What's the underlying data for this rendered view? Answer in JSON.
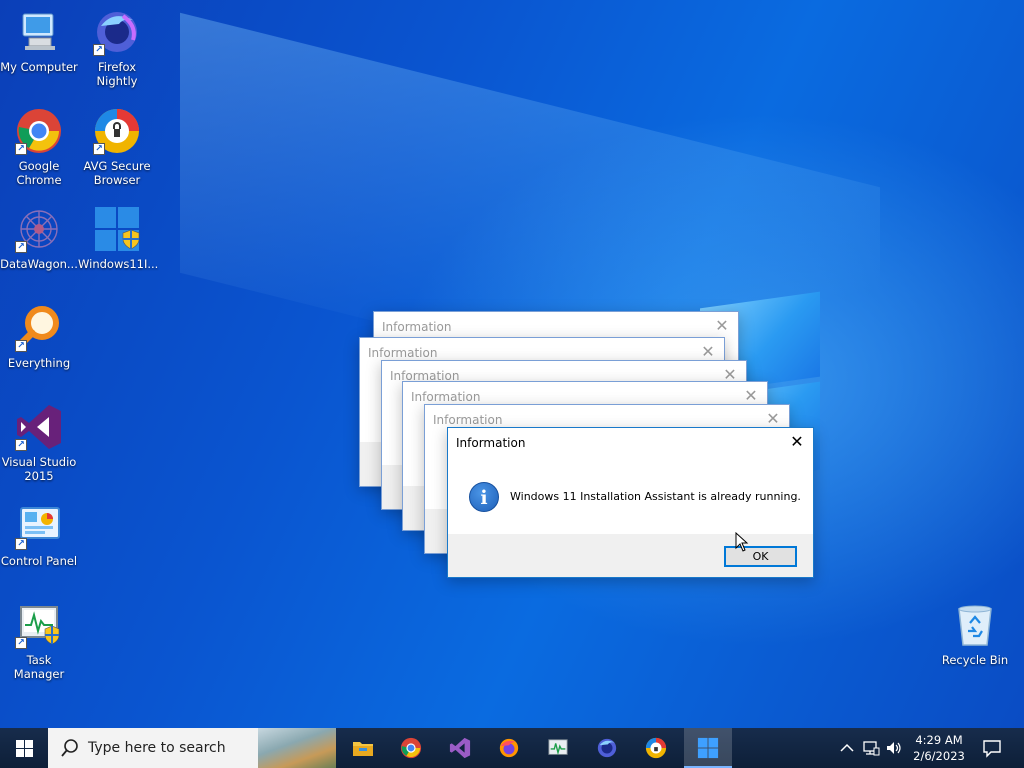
{
  "desktop": {
    "icons": [
      {
        "label": "My Computer",
        "icon": "computer-icon"
      },
      {
        "label": "Firefox Nightly",
        "icon": "firefox-nightly-icon"
      },
      {
        "label": "Google Chrome",
        "icon": "chrome-icon"
      },
      {
        "label": "AVG Secure Browser",
        "icon": "avg-browser-icon"
      },
      {
        "label": "DataWagon...",
        "icon": "datawagon-icon"
      },
      {
        "label": "Windows11I...",
        "icon": "windows11-installer-icon"
      },
      {
        "label": "Everything",
        "icon": "everything-search-icon"
      },
      {
        "label": "Visual Studio 2015",
        "icon": "visual-studio-icon"
      },
      {
        "label": "Control Panel",
        "icon": "control-panel-icon"
      },
      {
        "label": "Task Manager",
        "icon": "task-manager-icon"
      },
      {
        "label": "Recycle Bin",
        "icon": "recycle-bin-icon"
      }
    ]
  },
  "dialogs": {
    "stacked_title": "Information",
    "active": {
      "title": "Information",
      "message": "Windows 11 Installation Assistant is already running.",
      "ok_label": "OK",
      "close_glyph": "✕"
    }
  },
  "taskbar": {
    "search_placeholder": "Type here to search",
    "apps": [
      {
        "name": "file-explorer-icon"
      },
      {
        "name": "chrome-icon"
      },
      {
        "name": "visual-studio-icon"
      },
      {
        "name": "firefox-icon"
      },
      {
        "name": "task-manager-icon"
      },
      {
        "name": "firefox-nightly-icon"
      },
      {
        "name": "avg-browser-icon"
      },
      {
        "name": "windows11-installer-icon"
      }
    ],
    "clock": {
      "time": "4:29 AM",
      "date": "2/6/2023"
    }
  },
  "colors": {
    "accent": "#0078d7",
    "taskbar": "#10233f",
    "wallpaper": "#0a5fd6"
  }
}
